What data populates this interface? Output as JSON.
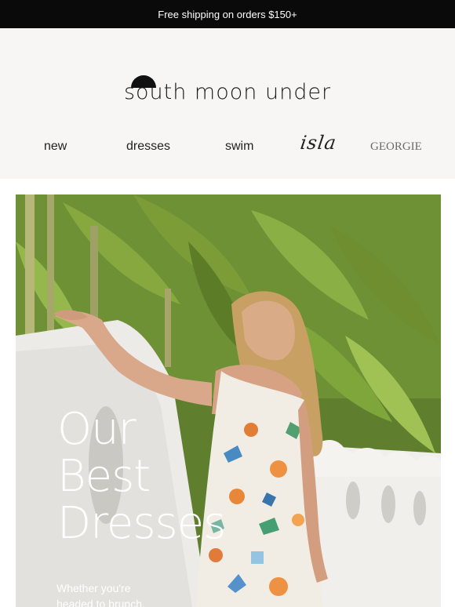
{
  "announcement": {
    "text": "Free shipping on orders $150+"
  },
  "brand": {
    "name": "south moon under",
    "logo_icon": "half-moon-icon"
  },
  "nav": {
    "items": [
      {
        "label": "new"
      },
      {
        "label": "dresses"
      },
      {
        "label": "swim"
      },
      {
        "label": "isla"
      },
      {
        "label": "GEORGIE"
      }
    ]
  },
  "hero": {
    "title_lines": [
      "Our",
      "Best",
      "Dresses"
    ],
    "subtitle_lines": [
      "Whether you're",
      "headed to brunch,"
    ]
  },
  "colors": {
    "topbar": "#0a0a0a",
    "header_bg": "#f8f6f4",
    "text_dark": "#1a1a1a",
    "hero_text": "#ffffff"
  }
}
